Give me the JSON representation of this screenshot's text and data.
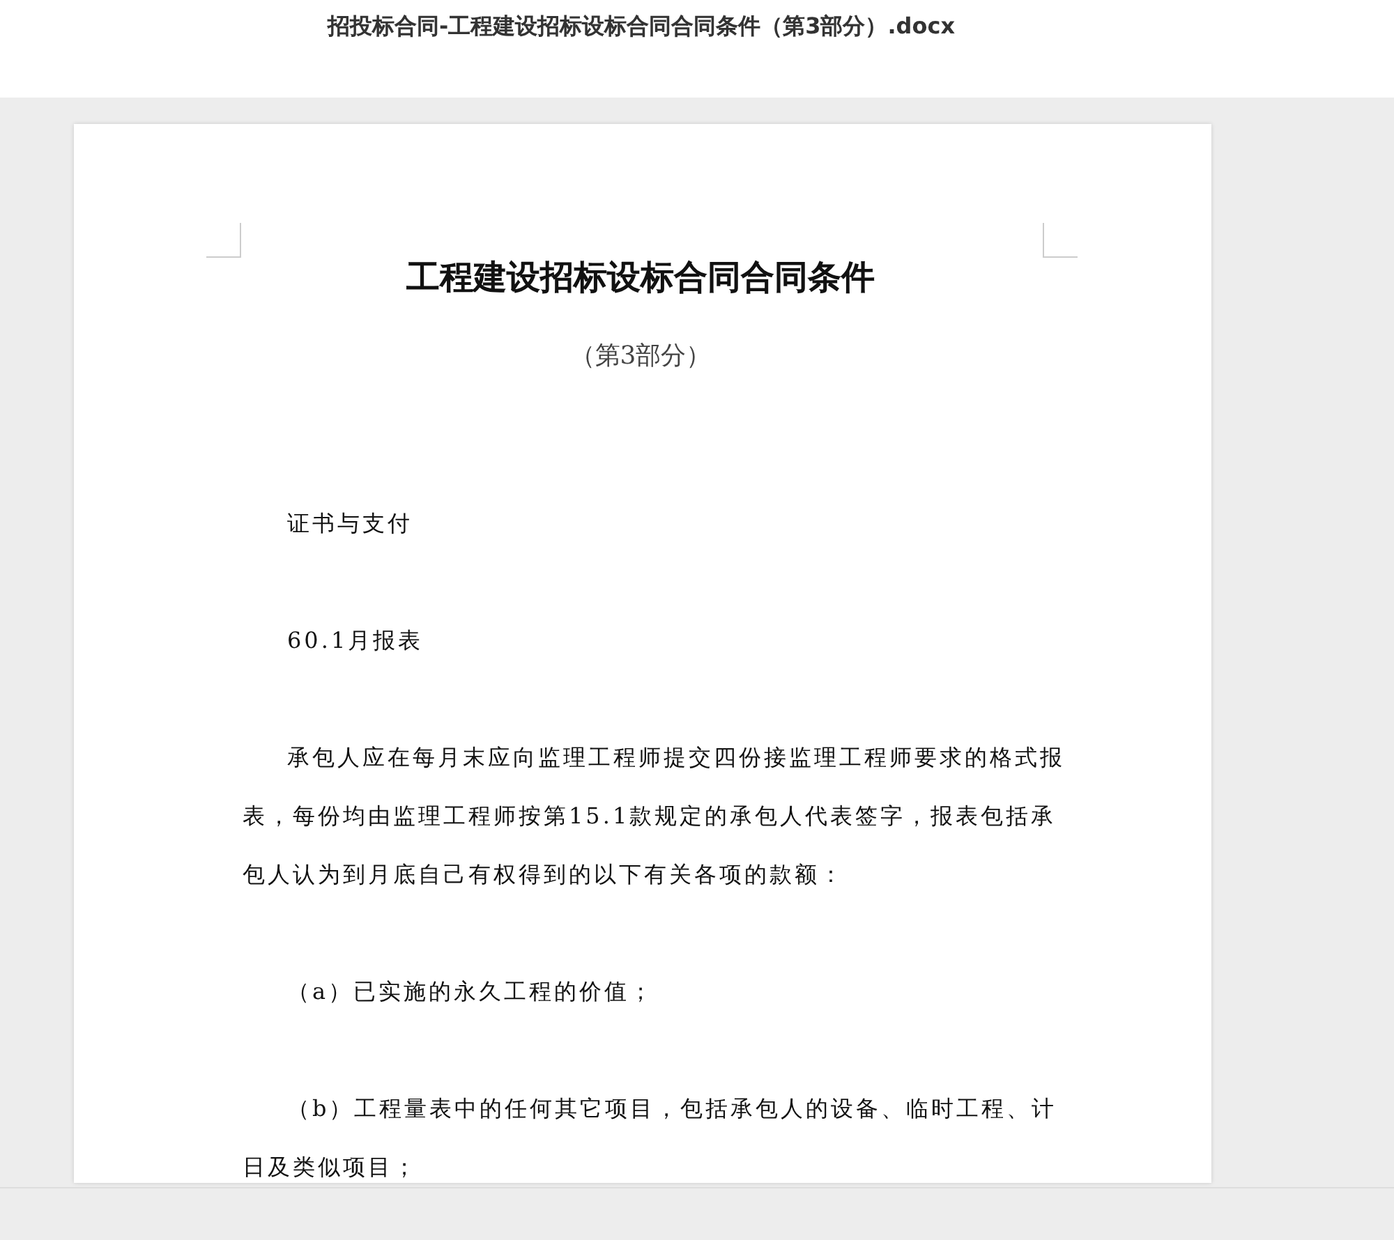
{
  "window": {
    "title": "招投标合同-工程建设招标设标合同合同条件（第3部分）.docx"
  },
  "document": {
    "title": "工程建设招标设标合同合同条件",
    "subtitle": "（第3部分）",
    "paragraphs": [
      "证书与支付",
      "60.1月报表",
      "承包人应在每月末应向监理工程师提交四份接监理工程师要求的格式报表，每份均由监理工程师按第15.1款规定的承包人代表签字，报表包括承包人认为到月底自己有权得到的以下有关各项的款额：",
      "（a）已实施的永久工程的价值；",
      "（b）工程量表中的任何其它项目，包括承包人的设备、临时工程、计日及类似项目；"
    ]
  }
}
